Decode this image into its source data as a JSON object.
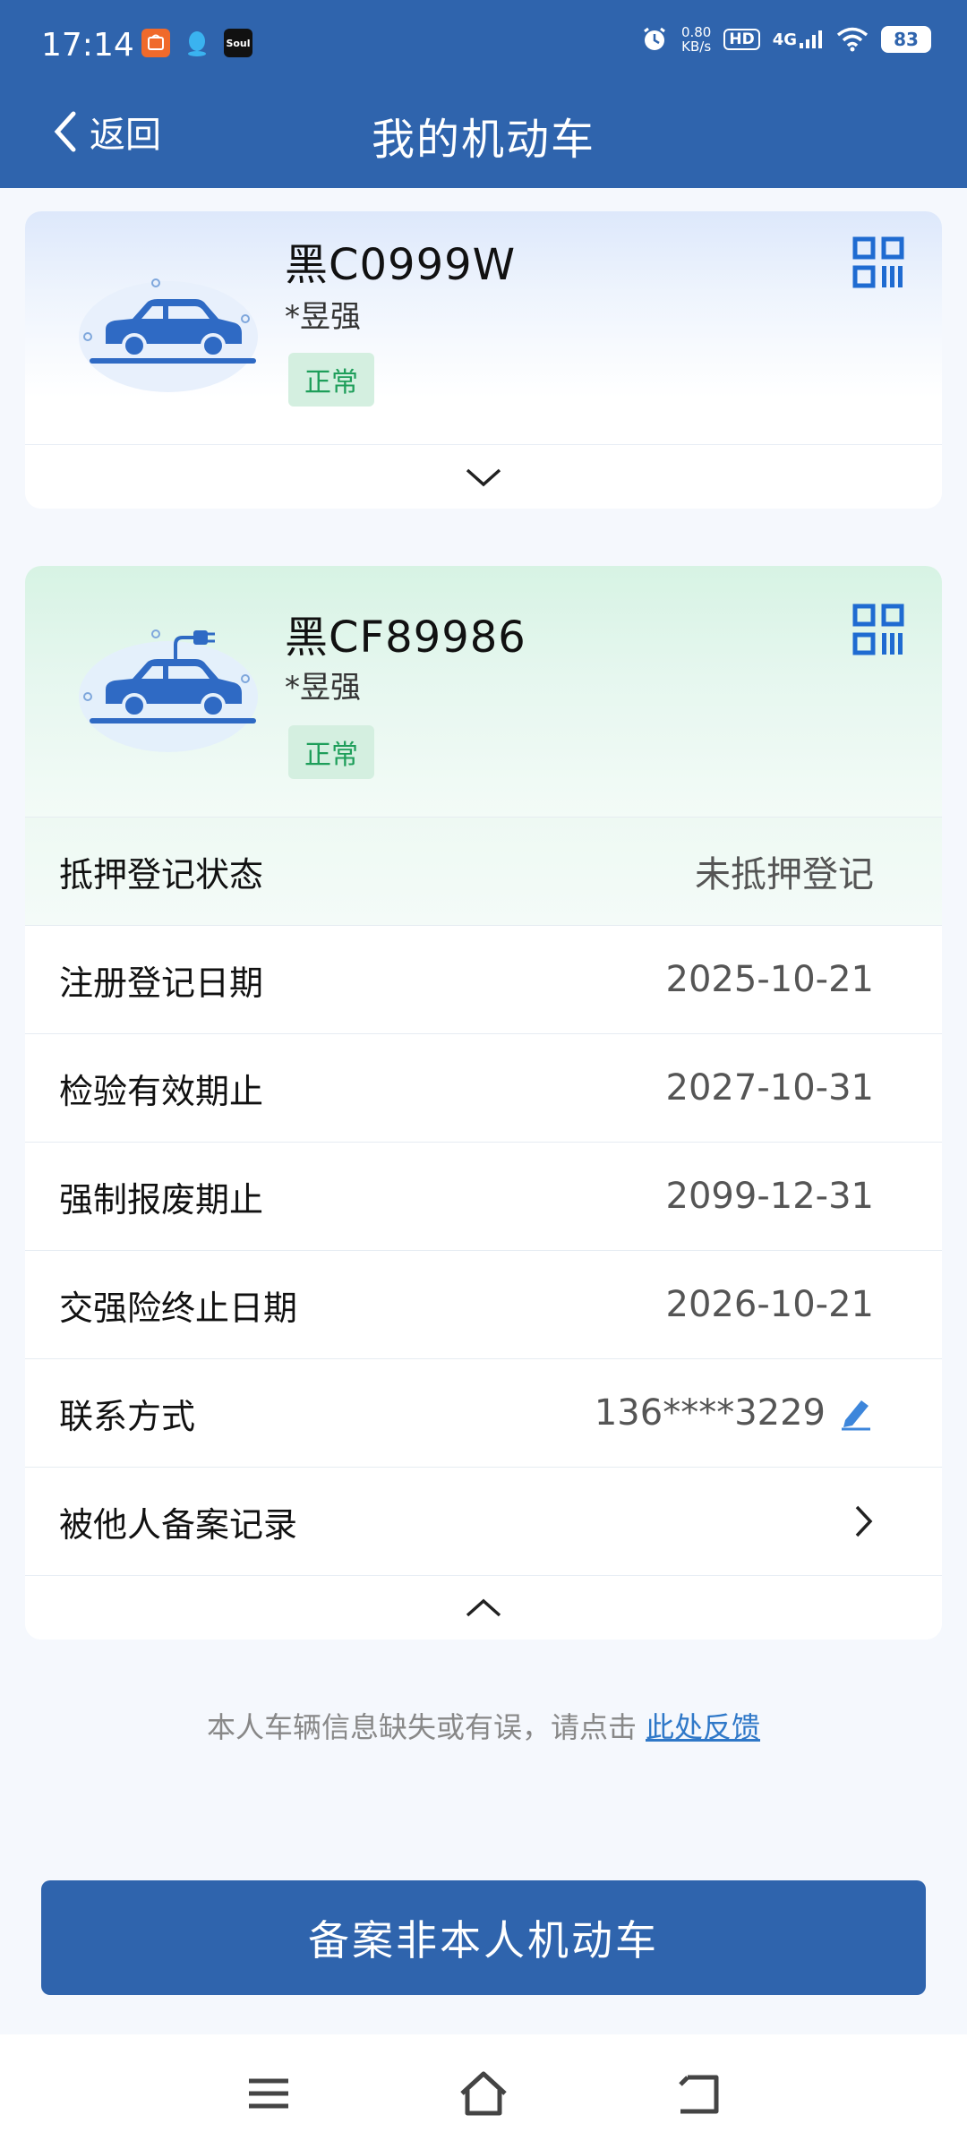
{
  "status_bar": {
    "time": "17:14",
    "net_speed_value": "0.80",
    "net_speed_unit": "KB/s",
    "hd": "HD",
    "network": "4G",
    "battery": "83",
    "app_icons": [
      "shop-app-icon",
      "qq-icon",
      "soul-app-icon"
    ],
    "soul_label": "Soul"
  },
  "header": {
    "back_label": "返回",
    "title": "我的机动车"
  },
  "vehicles": [
    {
      "plate": "黑C0999W",
      "owner": "*昱强",
      "status": "正常",
      "icon": "car-icon"
    },
    {
      "plate": "黑CF89986",
      "owner": "*昱强",
      "status": "正常",
      "icon": "electric-car-icon",
      "details": [
        {
          "label": "抵押登记状态",
          "value": "未抵押登记"
        },
        {
          "label": "注册登记日期",
          "value": "2025-10-21"
        },
        {
          "label": "检验有效期止",
          "value": "2027-10-31"
        },
        {
          "label": "强制报废期止",
          "value": "2099-12-31"
        },
        {
          "label": "交强险终止日期",
          "value": "2026-10-21"
        },
        {
          "label": "联系方式",
          "value": "136****3229"
        },
        {
          "label": "被他人备案记录",
          "value": ""
        }
      ]
    }
  ],
  "feedback": {
    "text": "本人车辆信息缺失或有误，请点击",
    "link": "此处反馈"
  },
  "primary_button": "备案非本人机动车",
  "colors": {
    "brand": "#2f64ad",
    "status_green": "#1e9e5a",
    "link": "#2f78c8"
  }
}
